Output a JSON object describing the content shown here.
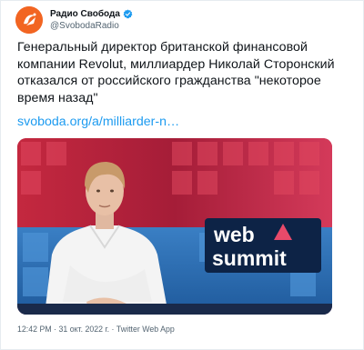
{
  "account": {
    "display_name": "Радио Свобода",
    "handle": "@SvobodaRadio"
  },
  "tweet": {
    "text": "Генеральный директор британской финансовой компании Revolut, миллиардер Николай Сторонский отказался от российского гражданства \"некоторое время назад\"",
    "link": "svoboda.org/a/milliarder-n…",
    "timestamp": "12:42 PM · 31 окт. 2022 г. · Twitter Web App"
  },
  "media": {
    "banner_line1": "web",
    "banner_line2": "summit"
  },
  "colors": {
    "brand_orange": "#f26522",
    "link_blue": "#1d9bf0",
    "verified_blue": "#1d9bf0"
  },
  "icons": [
    "svoboda-logo-icon",
    "verified-badge-icon"
  ]
}
